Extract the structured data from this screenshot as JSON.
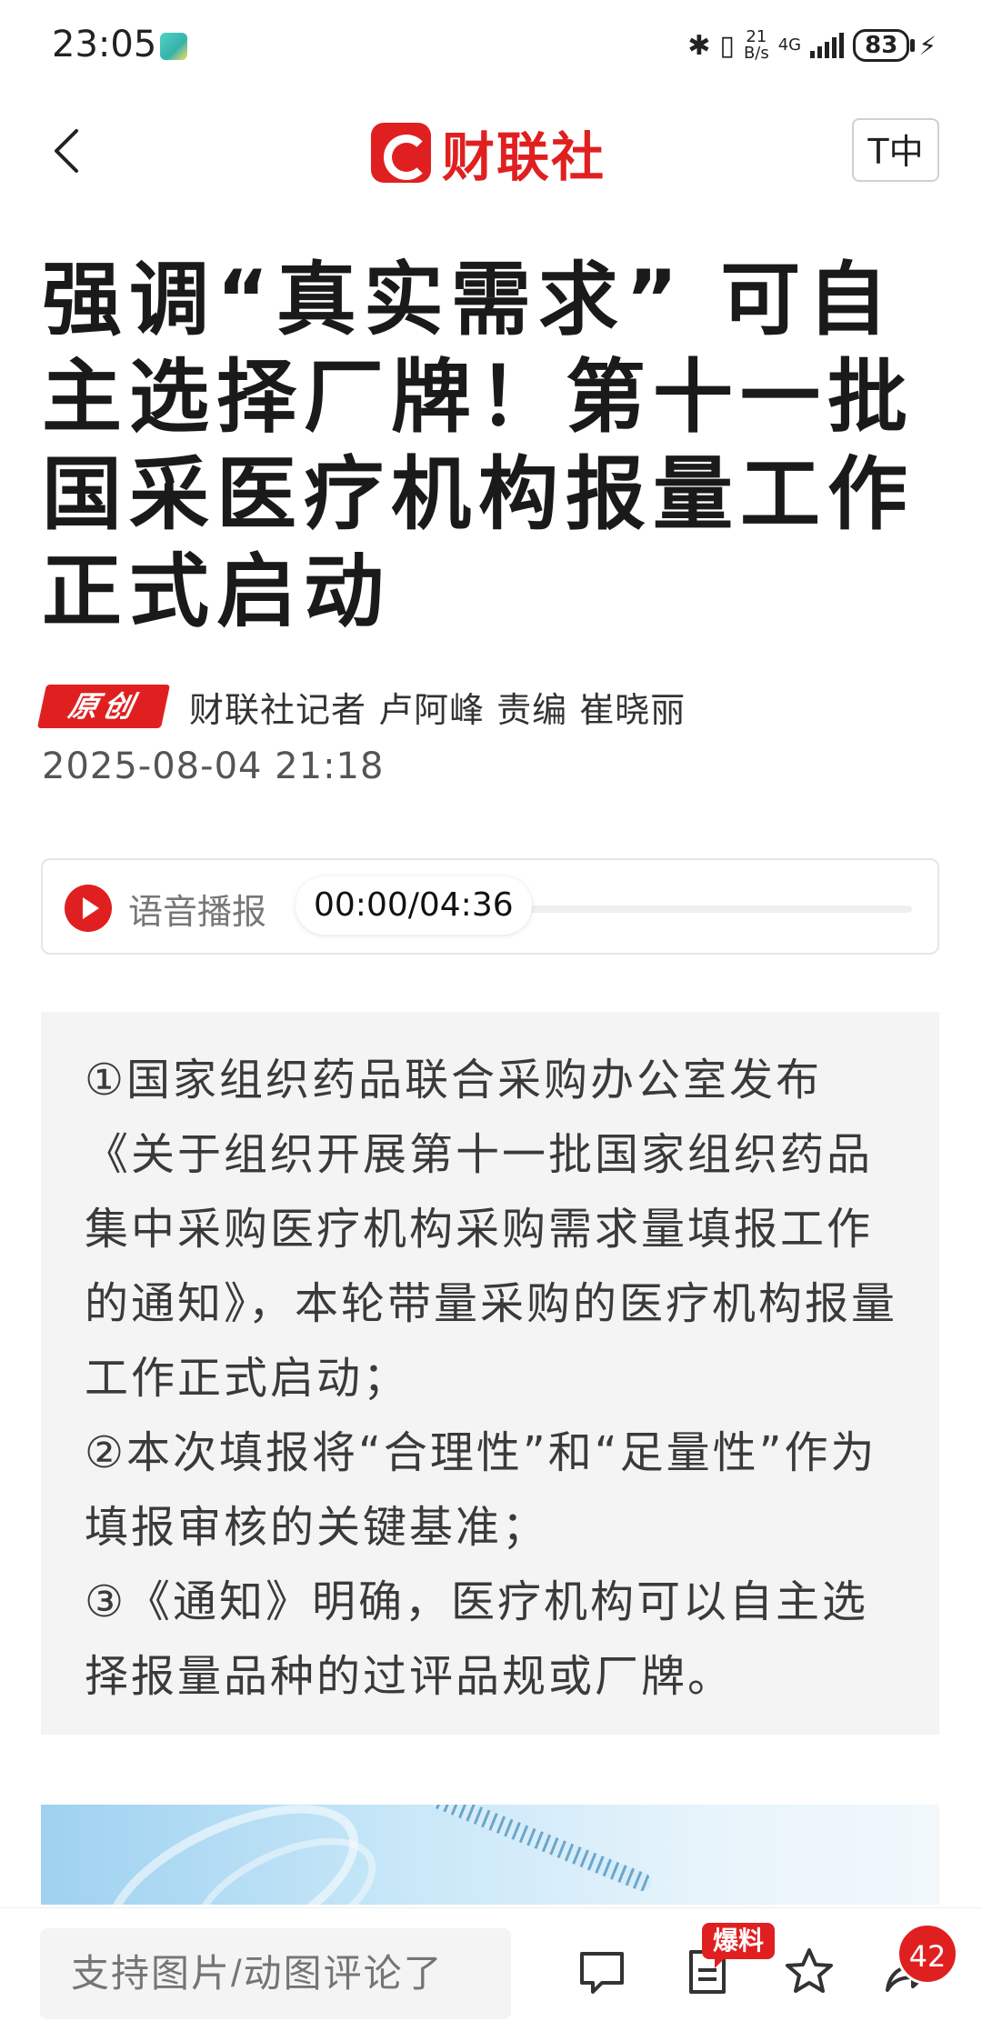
{
  "status_bar": {
    "time": "23:05",
    "net_speed": "21\nB/s",
    "net_type": "4G",
    "battery": "83"
  },
  "nav": {
    "logo_text": "财联社",
    "font_button": "T中"
  },
  "article": {
    "title": "强调“真实需求” 可自主选择厂牌！第十一批国采医疗机构报量工作正式启动",
    "badge": "原创",
    "byline": "财联社记者 卢阿峰  责编 崔晓丽",
    "date": "2025-08-04 21:18"
  },
  "audio": {
    "label": "语音播报",
    "time": "00:00/04:36",
    "progress": 0
  },
  "summary": [
    "①国家组织药品联合采购办公室发布《关于组织开展第十一批国家组织药品集中采购医疗机构采购需求量填报工作的通知》，本轮带量采购的医疗机构报量工作正式启动；",
    "②本次填报将“合理性”和“足量性”作为填报审核的关键基准；",
    "③《通知》明确，医疗机构可以自主选择报量品种的过评品规或厂牌。"
  ],
  "bottom_bar": {
    "comment_placeholder": "支持图片/动图评论了",
    "tip_badge": "爆料",
    "share_count": "42"
  },
  "colors": {
    "brand_red": "#e02020",
    "summary_bg": "#f4f4f4"
  },
  "icons": [
    "back-arrow-icon",
    "comment-icon",
    "document-icon",
    "star-icon",
    "share-icon",
    "bluetooth-icon",
    "signal-icon",
    "charging-icon"
  ]
}
